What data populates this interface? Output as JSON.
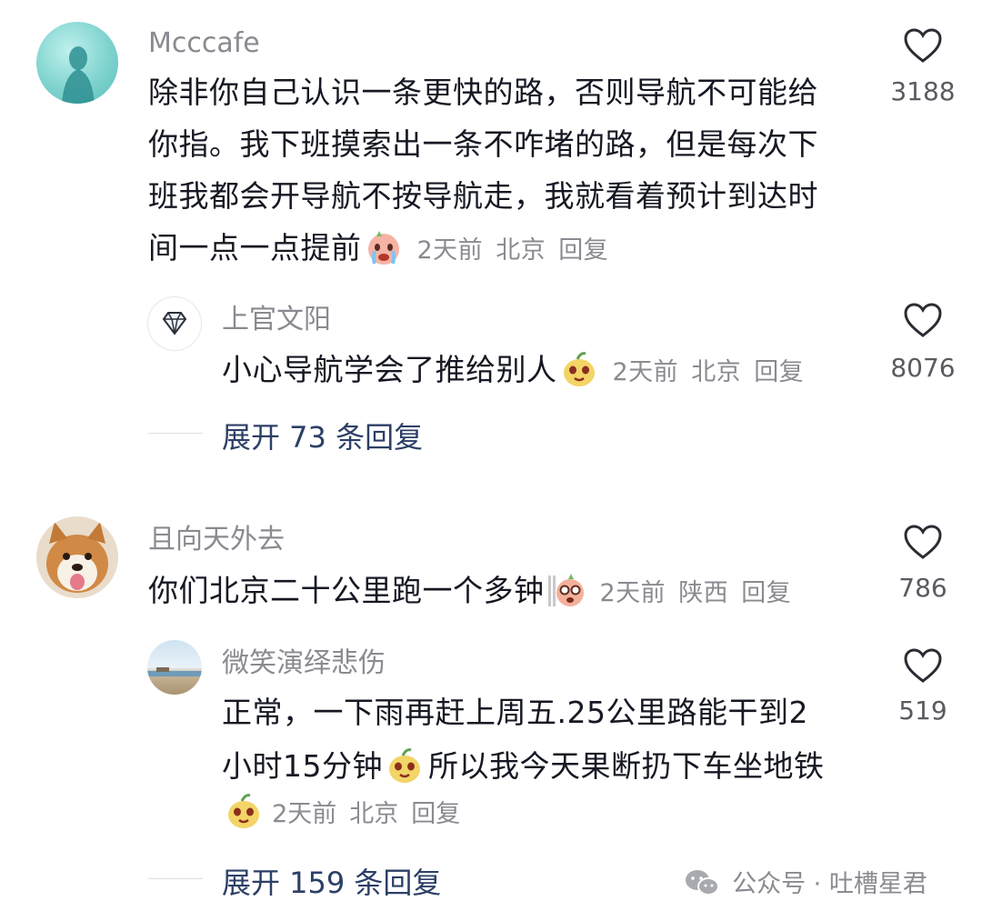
{
  "comments": [
    {
      "username": "Mcccafe",
      "lines": [
        "除非你自己认识一条更快的路，否则导航不可能给",
        "你指。我下班摸索出一条不咋堵的路，但是每次下",
        "班我都会开导航不按导航走，我就看着预计到达时",
        "间一点一点提前"
      ],
      "time": "2天前",
      "location": "北京",
      "reply": "回复",
      "likes": "3188"
    },
    {
      "username": "上官文阳",
      "text": "小心导航学会了推给别人",
      "time": "2天前",
      "location": "北京",
      "reply": "回复",
      "likes": "8076"
    },
    {
      "username": "且向天外去",
      "text": "你们北京二十公里跑一个多钟",
      "time": "2天前",
      "location": "陕西",
      "reply": "回复",
      "likes": "786"
    },
    {
      "username": "微笑演绎悲伤",
      "line1": "正常，一下雨再赶上周五.25公里路能干到2",
      "line2a": "小时15分钟",
      "line2b": "所以我今天果断扔下车坐地铁",
      "time": "2天前",
      "location": "北京",
      "reply": "回复",
      "likes": "519"
    }
  ],
  "expand1": "展开 73 条回复",
  "expand2": "展开 159 条回复",
  "watermark": "公众号 · 吐槽星君",
  "colors": {
    "link": "#2c3f66",
    "secondary": "#8a8b91",
    "text": "#161823"
  }
}
